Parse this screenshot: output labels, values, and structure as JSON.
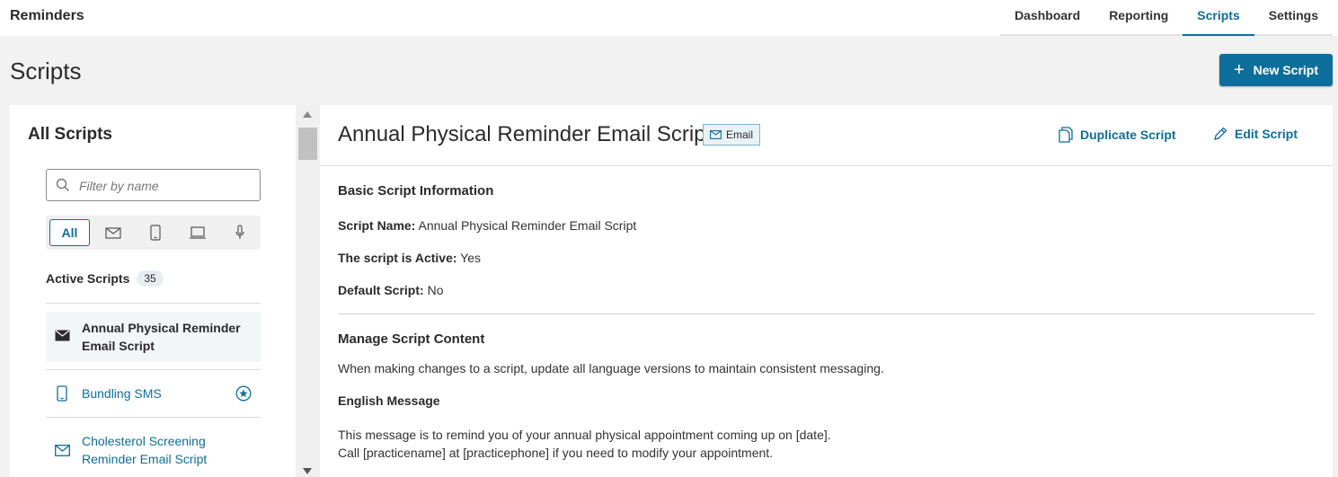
{
  "app": {
    "title": "Reminders"
  },
  "nav": {
    "tabs": [
      {
        "label": "Dashboard",
        "active": false
      },
      {
        "label": "Reporting",
        "active": false
      },
      {
        "label": "Scripts",
        "active": true
      },
      {
        "label": "Settings",
        "active": false
      }
    ]
  },
  "page": {
    "title": "Scripts",
    "new_button": "New Script"
  },
  "sidebar": {
    "heading": "All Scripts",
    "filter_placeholder": "Filter by name",
    "type_filters": [
      {
        "label": "All",
        "icon": "all",
        "selected": true
      },
      {
        "icon": "email-icon"
      },
      {
        "icon": "mobile-icon"
      },
      {
        "icon": "laptop-icon"
      },
      {
        "icon": "microphone-icon"
      }
    ],
    "active_label": "Active Scripts",
    "active_count": "35",
    "items": [
      {
        "label": "Annual Physical Reminder Email Script",
        "icon": "email-filled-icon",
        "selected": true
      },
      {
        "label": "Bundling SMS",
        "icon": "mobile-icon",
        "default": true
      },
      {
        "label": "Cholesterol Screening Reminder Email Script",
        "icon": "email-icon"
      }
    ]
  },
  "detail": {
    "title": "Annual Physical Reminder Email Script",
    "badge": "Email",
    "duplicate_label": "Duplicate Script",
    "edit_label": "Edit Script",
    "basic_heading": "Basic Script Information",
    "script_name_label": "Script Name:",
    "script_name_value": "Annual Physical Reminder Email Script",
    "active_label": "The script is Active:",
    "active_value": "Yes",
    "default_label": "Default Script:",
    "default_value": "No",
    "manage_heading": "Manage Script Content",
    "manage_note": "When making changes to a script, update all language versions to maintain consistent messaging.",
    "english_heading": "English Message",
    "message_line1": "This message is to remind you of your annual physical appointment coming up on [date].",
    "message_line2": "Call [practicename] at [practicephone] if you need to modify your appointment."
  },
  "colors": {
    "accent": "#0e6e9b",
    "background": "#f2f2f2",
    "badge_bg": "#e8f2f7"
  }
}
